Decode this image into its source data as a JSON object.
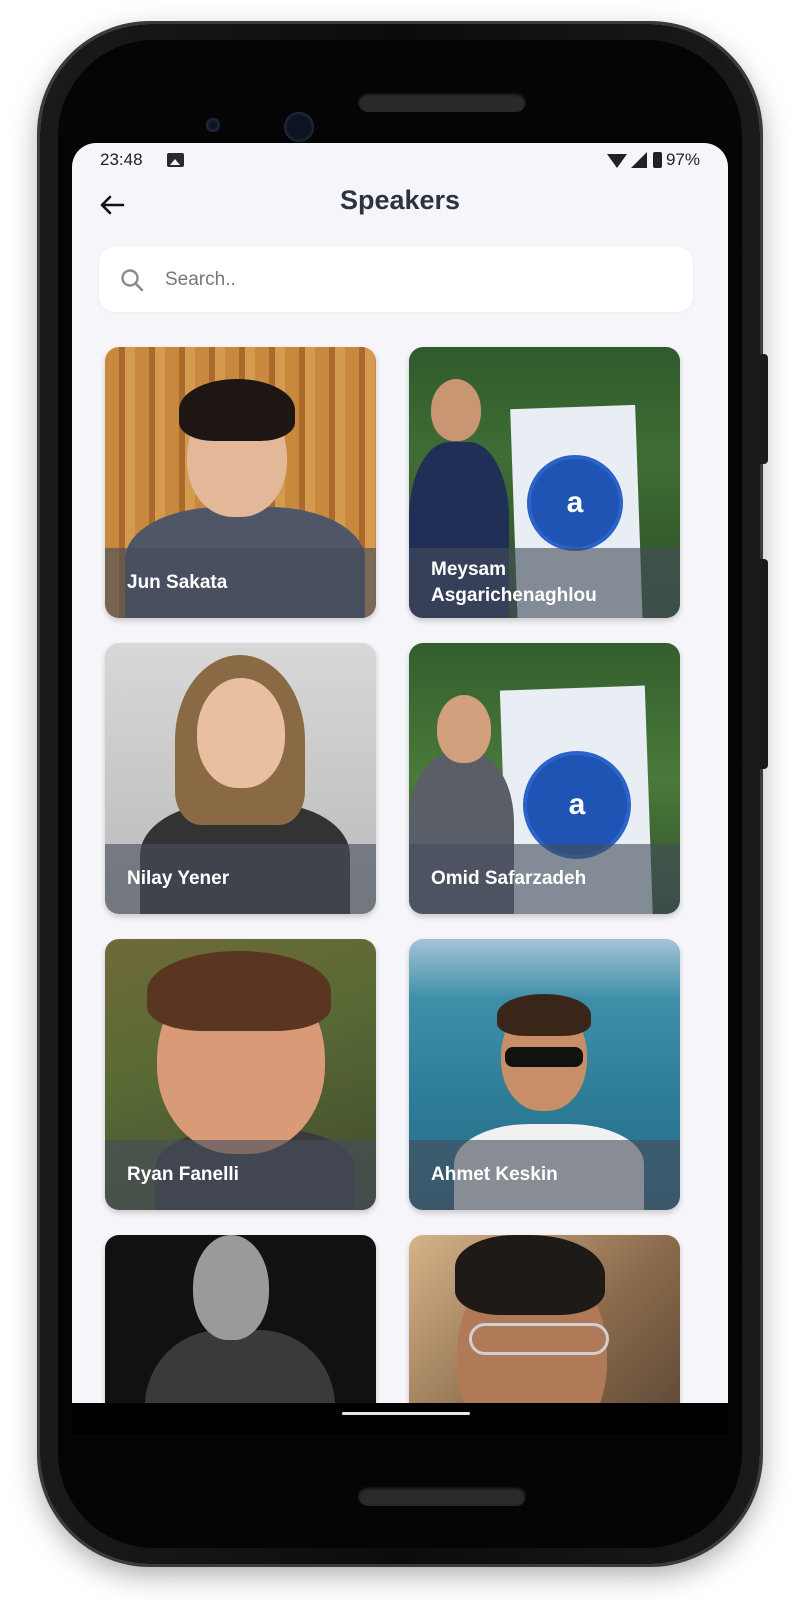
{
  "status_bar": {
    "time": "23:48",
    "battery": "97%",
    "icons": [
      "image-icon",
      "wifi-icon",
      "signal-icon",
      "battery-icon"
    ]
  },
  "app_bar": {
    "back_icon": "arrow-left-icon",
    "title": "Speakers"
  },
  "search": {
    "icon": "search-icon",
    "placeholder": "Search.."
  },
  "speakers": [
    {
      "name": "Jun Sakata"
    },
    {
      "name": "Meysam Asgarichenaghlou"
    },
    {
      "name": "Nilay Yener"
    },
    {
      "name": "Omid Safarzadeh"
    },
    {
      "name": "Ryan Fanelli"
    },
    {
      "name": "Ahmet Keskin"
    },
    {
      "name": ""
    },
    {
      "name": ""
    }
  ],
  "colors": {
    "background": "#f6f6fa",
    "title": "#2d3440",
    "label_overlay": "#464e5c"
  }
}
